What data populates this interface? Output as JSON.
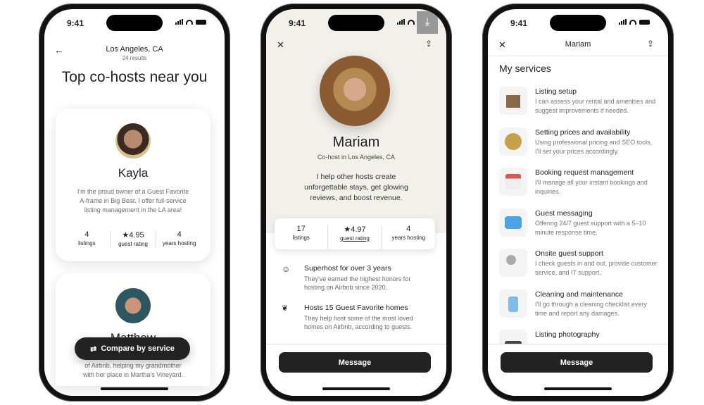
{
  "status_time": "9:41",
  "screen1": {
    "location": "Los Angeles, CA",
    "results": "24 results",
    "title": "Top co-hosts near you",
    "hosts": [
      {
        "name": "Kayla",
        "bio": [
          "I'm the proud owner of a Guest Favorite",
          "A-frame in Big Bear. I offer full-service",
          "listing management in the LA area!"
        ],
        "stats": [
          {
            "value": "4",
            "label": "listings"
          },
          {
            "value": "★4.95",
            "label": "guest rating"
          },
          {
            "value": "4",
            "label": "years hosting"
          }
        ]
      },
      {
        "name": "Matthew",
        "bio": [
          "of Airbnb, helping my grandmother",
          "with her place in Martha's Vineyard."
        ]
      }
    ],
    "compare_button": "Compare by service"
  },
  "screen2": {
    "name": "Mariam",
    "subtitle": "Co-host in Los Angeles, CA",
    "bio": [
      "I help other hosts create",
      "unforgettable stays, get glowing",
      "reviews, and boost revenue."
    ],
    "stats": [
      {
        "value": "17",
        "label": "listings"
      },
      {
        "value": "★4.97",
        "label": "guest rating"
      },
      {
        "value": "4",
        "label": "years hosting"
      }
    ],
    "highlights": [
      {
        "icon": "superhost-icon",
        "title": "Superhost for over 3 years",
        "desc": [
          "They've earned the highest honors for",
          "hosting on Airbnb since 2020."
        ]
      },
      {
        "icon": "laurel-icon",
        "title": "Hosts 15 Guest Favorite homes",
        "desc": [
          "They help host some of the most loved",
          "homes on Airbnb, according to guests."
        ]
      }
    ],
    "message_button": "Message"
  },
  "screen3": {
    "header": "Mariam",
    "section_title": "My services",
    "services": [
      {
        "icon": "cabin-icon",
        "title": "Listing setup",
        "desc": "I can assess your rental and amenities and suggest improvements if needed."
      },
      {
        "icon": "coin-icon",
        "title": "Setting prices and availability",
        "desc": "Using professional pricing and SEO tools, I'll set your prices accordingly."
      },
      {
        "icon": "calendar-icon",
        "title": "Booking request management",
        "desc": "I'll manage all your instant bookings and inquiries."
      },
      {
        "icon": "chat-bubble-icon",
        "title": "Guest messaging",
        "desc": "Offering 24/7 guest support with a 5–10 minute response time."
      },
      {
        "icon": "key-icon",
        "title": "Onsite guest support",
        "desc": "I check guests in and out, provide customer service, and IT support."
      },
      {
        "icon": "spray-bottle-icon",
        "title": "Cleaning and maintenance",
        "desc": "I'll go through a cleaning checklist every time and report any damages."
      },
      {
        "icon": "camera-icon",
        "title": "Listing photography",
        "desc": ""
      }
    ],
    "message_button": "Message"
  },
  "colors": {
    "profile_bg": "#f2f0eb",
    "button": "#222222"
  }
}
